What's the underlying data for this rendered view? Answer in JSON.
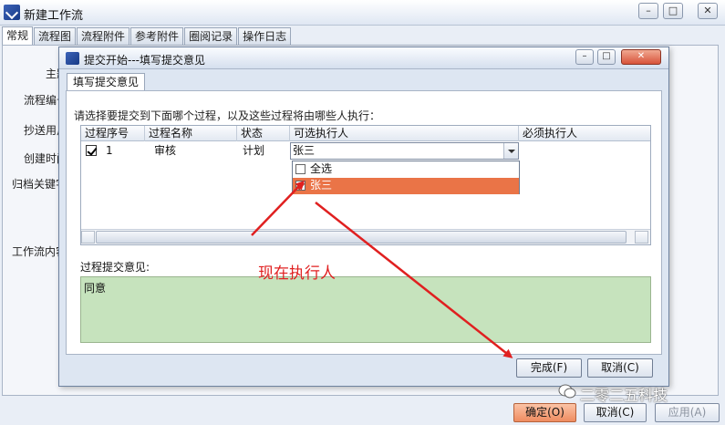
{
  "outer": {
    "title": "新建工作流",
    "tabs": [
      "常规",
      "流程图",
      "流程附件",
      "参考附件",
      "圈阅记录",
      "操作日志"
    ],
    "fields": [
      "主题",
      "流程编号",
      "抄送用户",
      "创建时间",
      "归档关键字",
      "工作流内容"
    ],
    "buttons": {
      "ok": "确定(O)",
      "cancel": "取消(C)",
      "apply": "应用(A)"
    }
  },
  "dialog": {
    "title": "提交开始---填写提交意见",
    "tab": "填写提交意见",
    "instruction": "请选择要提交到下面哪个过程，以及这些过程将由哪些人执行：",
    "columns": [
      "过程序号",
      "过程名称",
      "状态",
      "可选执行人",
      "必须执行人"
    ],
    "rows": [
      {
        "checked": true,
        "seq": "1",
        "name": "审核",
        "status": "计划",
        "executor": "张三",
        "required": ""
      }
    ],
    "dropdown": [
      {
        "label": "全选",
        "checked": false,
        "selected": false
      },
      {
        "label": "张三",
        "checked": true,
        "selected": true
      }
    ],
    "opinion_label": "过程提交意见:",
    "opinion_value": "同意",
    "buttons": {
      "finish": "完成(F)",
      "cancel": "取消(C)"
    }
  },
  "annotation": {
    "text": "现在执行人",
    "color": "#e02020"
  },
  "watermark": {
    "text": "二零二五科技"
  },
  "colors": {
    "selected_row": "#ea7447",
    "opinion_bg": "#c6e3bd",
    "ok_button": "#ef8c60"
  }
}
